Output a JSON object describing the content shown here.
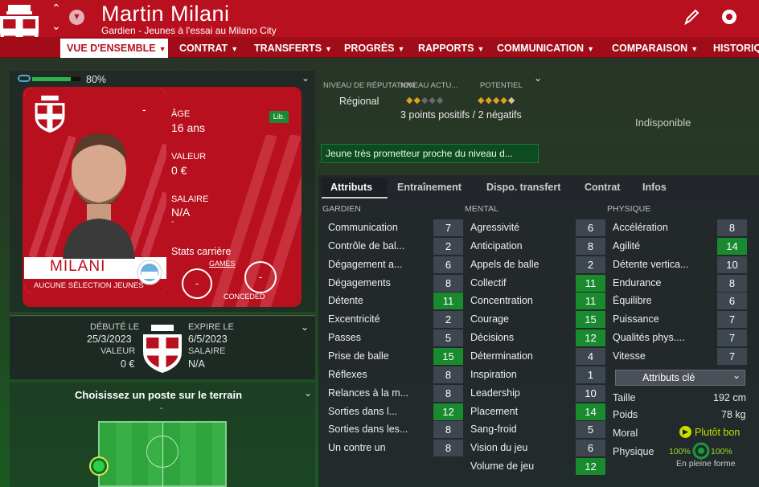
{
  "header": {
    "name": "Martin Milani",
    "subtitle": "Gardien - Jeunes à l'essai au Milano City"
  },
  "nav": {
    "active": "VUE D'ENSEMBLE",
    "items": [
      "CONTRAT",
      "TRANSFERTS",
      "PROGRÈS",
      "RAPPORTS",
      "COMMUNICATION",
      "COMPARAISON",
      "HISTORIQ"
    ]
  },
  "card": {
    "condition": "80%",
    "age_label": "ÂGE",
    "age": "16 ans",
    "value_label": "VALEUR",
    "value": "0 €",
    "salary_label": "SALAIRE",
    "salary": "N/A",
    "dash": "-",
    "dash2": "-",
    "lib": "Lib.",
    "career_label": "Stats carrière",
    "games_label": "GAMES",
    "conceded_label": "CONCEDED",
    "games": "-",
    "conceded": "-",
    "surname": "MILANI",
    "selection": "AUCUNE SÉLECTION JEUNES"
  },
  "contract": {
    "debut_label": "DÉBUTÉ LE",
    "debut": "25/3/2023",
    "expire_label": "EXPIRE LE",
    "expire": "6/5/2023",
    "value_label": "VALEUR",
    "value": "0 €",
    "salary_label": "SALAIRE",
    "salary": "N/A"
  },
  "position": {
    "title": "Choisissez un poste sur le terrain",
    "dash": "-"
  },
  "reputation": {
    "rep_label": "NIVEAU DE RÉPUTATION",
    "level_label": "NIVEAU ACTU...",
    "potential_label": "POTENTIEL",
    "rep_value": "Régional",
    "current_stars": 2,
    "potential_stars": 4.5,
    "points": "3 points positifs / 2 négatifs",
    "desc": "Jeune très prometteur proche du niveau d..."
  },
  "unavailable": "Indisponible",
  "tabs": [
    "Attributs",
    "Entraînement",
    "Dispo. transfert",
    "Contrat",
    "Infos"
  ],
  "sections": {
    "gk": "GARDIEN",
    "mental": "MENTAL",
    "physical": "PHYSIQUE"
  },
  "gk": [
    [
      "Communication",
      "7"
    ],
    [
      "Contrôle de bal...",
      "2"
    ],
    [
      "Dégagement a...",
      "6"
    ],
    [
      "Dégagements",
      "8"
    ],
    [
      "Détente",
      "11"
    ],
    [
      "Excentricité",
      "2"
    ],
    [
      "Passes",
      "5"
    ],
    [
      "Prise de balle",
      "15"
    ],
    [
      "Réflexes",
      "8"
    ],
    [
      "Relances à la m...",
      "8"
    ],
    [
      "Sorties dans l...",
      "12"
    ],
    [
      "Sorties dans les...",
      "8"
    ],
    [
      "Un contre un",
      "8"
    ]
  ],
  "mental": [
    [
      "Agressivité",
      "6"
    ],
    [
      "Anticipation",
      "8"
    ],
    [
      "Appels de balle",
      "2"
    ],
    [
      "Collectif",
      "11"
    ],
    [
      "Concentration",
      "11"
    ],
    [
      "Courage",
      "15"
    ],
    [
      "Décisions",
      "12"
    ],
    [
      "Détermination",
      "4"
    ],
    [
      "Inspiration",
      "1"
    ],
    [
      "Leadership",
      "10"
    ],
    [
      "Placement",
      "14"
    ],
    [
      "Sang-froid",
      "5"
    ],
    [
      "Vision du jeu",
      "6"
    ],
    [
      "Volume de jeu",
      "12"
    ]
  ],
  "physical": [
    [
      "Accélération",
      "8"
    ],
    [
      "Agilité",
      "14"
    ],
    [
      "Détente vertica...",
      "10"
    ],
    [
      "Endurance",
      "8"
    ],
    [
      "Équilibre",
      "6"
    ],
    [
      "Puissance",
      "7"
    ],
    [
      "Qualités phys....",
      "7"
    ],
    [
      "Vitesse",
      "7"
    ]
  ],
  "key": {
    "dropdown": "Attributs clé",
    "height_label": "Taille",
    "height": "192 cm",
    "weight_label": "Poids",
    "weight": "78 kg",
    "morale_label": "Moral",
    "morale": "Plutôt bon",
    "phys_label": "Physique",
    "p1": "100%",
    "p2": "100%",
    "form": "En pleine forme"
  },
  "colors": {
    "brand": "#b8101e",
    "green": "#1a8a2e",
    "grey": "#3e4650"
  }
}
